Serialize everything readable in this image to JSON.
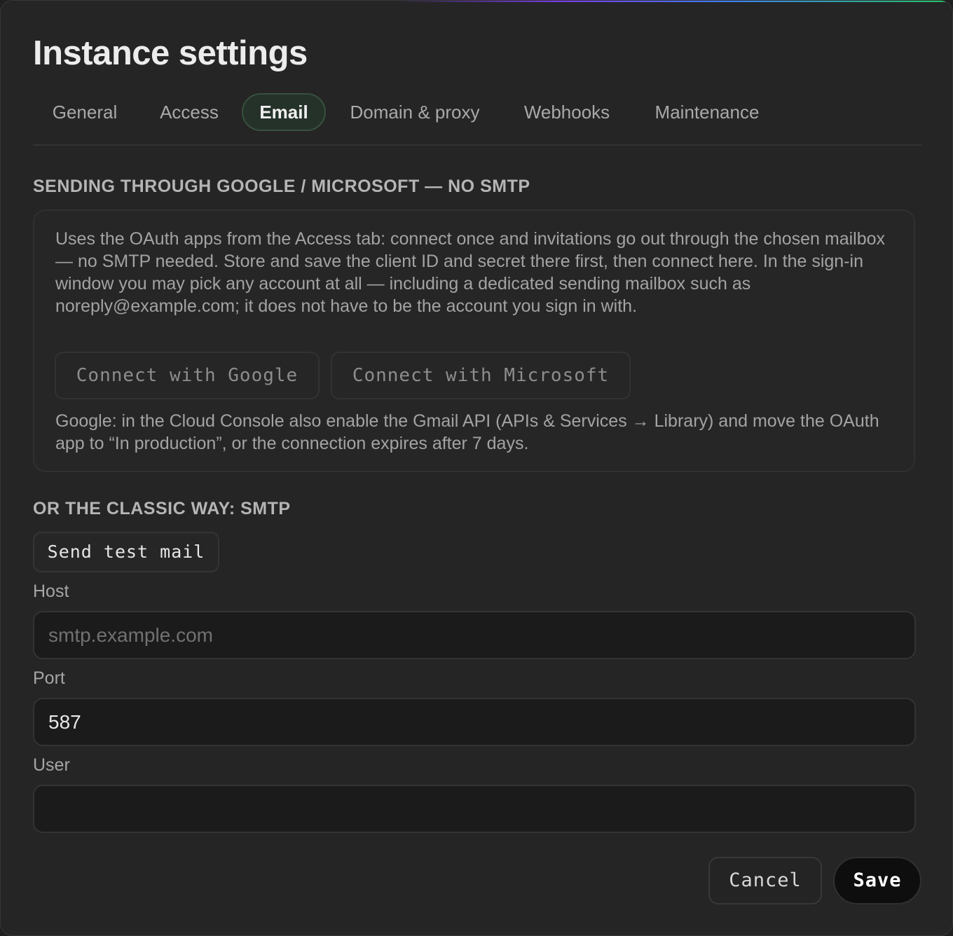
{
  "dialog": {
    "title": "Instance settings"
  },
  "tabs": [
    {
      "label": "General",
      "active": false
    },
    {
      "label": "Access",
      "active": false
    },
    {
      "label": "Email",
      "active": true
    },
    {
      "label": "Domain & proxy",
      "active": false
    },
    {
      "label": "Webhooks",
      "active": false
    },
    {
      "label": "Maintenance",
      "active": false
    }
  ],
  "oauth_section": {
    "heading": "SENDING THROUGH GOOGLE / MICROSOFT — NO SMTP",
    "description": "Uses the OAuth apps from the Access tab: connect once and invitations go out through the chosen mailbox — no SMTP needed. Store and save the client ID and secret there first, then connect here. In the sign-in window you may pick any account at all — including a dedicated sending mailbox such as noreply@example.com; it does not have to be the account you sign in with.",
    "google_button": "Connect with Google",
    "microsoft_button": "Connect with Microsoft",
    "note": "Google: in the Cloud Console also enable the Gmail API (APIs & Services → Library) and move the OAuth app to “In production”, or the connection expires after 7 days."
  },
  "smtp_section": {
    "heading": "OR THE CLASSIC WAY: SMTP",
    "test_button": "Send test mail",
    "host": {
      "label": "Host",
      "value": "",
      "placeholder": "smtp.example.com"
    },
    "port": {
      "label": "Port",
      "value": "587",
      "placeholder": ""
    },
    "user": {
      "label": "User",
      "value": "",
      "placeholder": ""
    }
  },
  "footer": {
    "cancel_label": "Cancel",
    "save_label": "Save"
  },
  "colors": {
    "dialog_bg": "#252525",
    "active_tab_bg": "#253229",
    "active_tab_border": "#36523e",
    "input_bg": "#1b1b1b",
    "save_bg": "#0e0e0e"
  }
}
